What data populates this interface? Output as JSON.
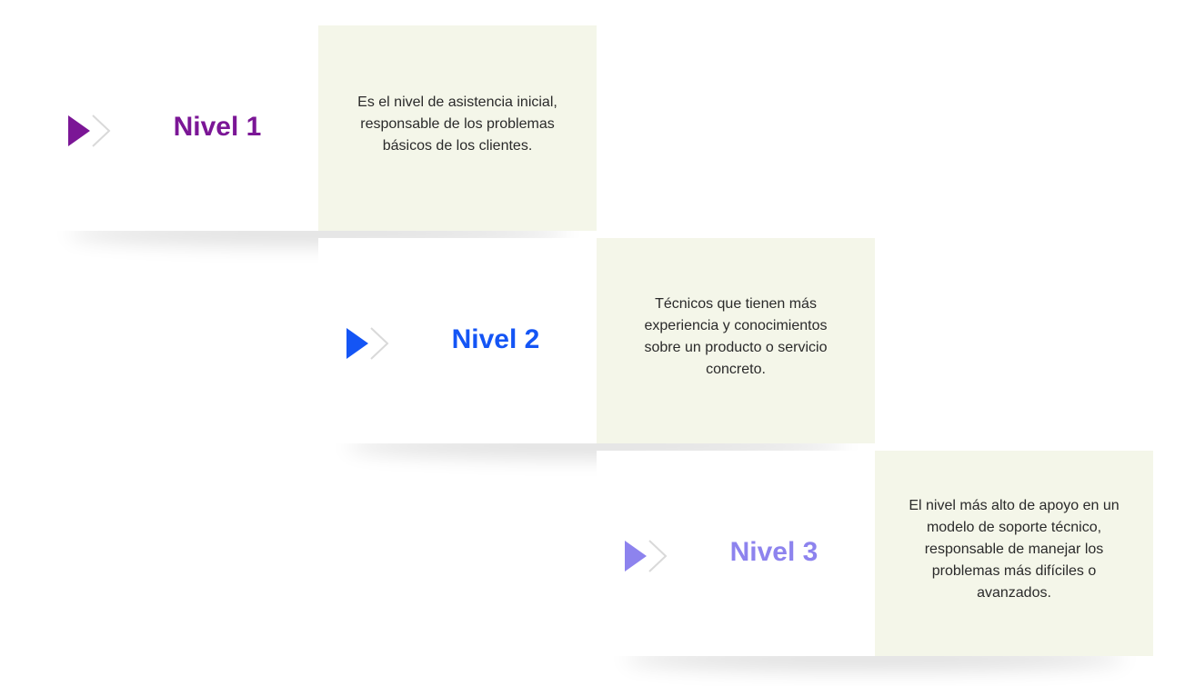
{
  "levels": [
    {
      "title": "Nivel 1",
      "description": "Es el nivel de asistencia inicial, responsable de los problemas básicos de los clientes.",
      "color": "#7b1696",
      "icon": "chevron-arrow-icon"
    },
    {
      "title": "Nivel 2",
      "description": "Técnicos que tienen más experiencia y conocimientos sobre un producto o servicio concreto.",
      "color": "#1455f5",
      "icon": "chevron-arrow-icon"
    },
    {
      "title": "Nivel 3",
      "description": "El nivel más alto de apoyo en un modelo de soporte técnico, responsable de manejar los problemas más difíciles o avanzados.",
      "color": "#8d83ee",
      "icon": "chevron-arrow-icon"
    }
  ],
  "colors": {
    "description_background": "#f4f6e9",
    "chevron_outline": "#d9d9d9",
    "text": "#2a2a2a"
  }
}
